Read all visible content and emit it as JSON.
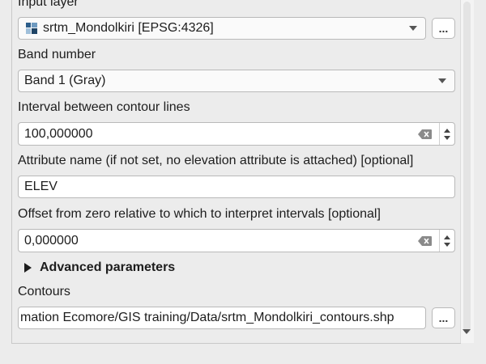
{
  "input_layer": {
    "label": "Input layer",
    "value": "srtm_Mondolkiri [EPSG:4326]",
    "icon": "raster-layer-icon",
    "browse_label": "..."
  },
  "band_number": {
    "label": "Band number",
    "value": "Band 1 (Gray)"
  },
  "interval": {
    "label": "Interval between contour lines",
    "value": "100,000000"
  },
  "attribute_name": {
    "label": "Attribute name (if not set, no elevation attribute is attached) [optional]",
    "value": "ELEV"
  },
  "offset": {
    "label": "Offset from zero relative to which to interpret intervals [optional]",
    "value": "0,000000"
  },
  "advanced": {
    "label": "Advanced parameters"
  },
  "contours": {
    "label": "Contours",
    "value": "mation Ecomore/GIS training/Data/srtm_Mondolkiri_contours.shp",
    "browse_label": "..."
  }
}
